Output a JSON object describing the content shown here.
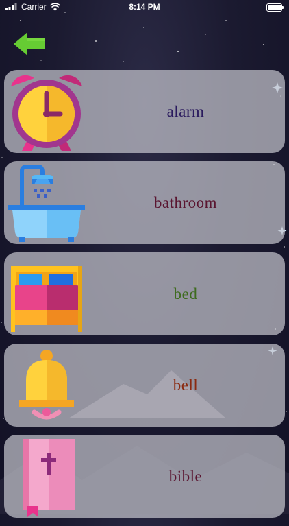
{
  "status_bar": {
    "carrier": "Carrier",
    "time": "8:14 PM"
  },
  "back_button": {
    "icon": "arrow-left-icon",
    "color": "#66cc33"
  },
  "words": [
    {
      "label": "alarm",
      "color": "#2a1a5e",
      "icon": "alarm-clock-icon"
    },
    {
      "label": "bathroom",
      "color": "#5a1530",
      "icon": "bathtub-shower-icon"
    },
    {
      "label": "bed",
      "color": "#3e6b1f",
      "icon": "bed-icon"
    },
    {
      "label": "bell",
      "color": "#8a2a10",
      "icon": "bell-icon"
    },
    {
      "label": "bible",
      "color": "#5a1530",
      "icon": "bible-book-icon"
    }
  ]
}
